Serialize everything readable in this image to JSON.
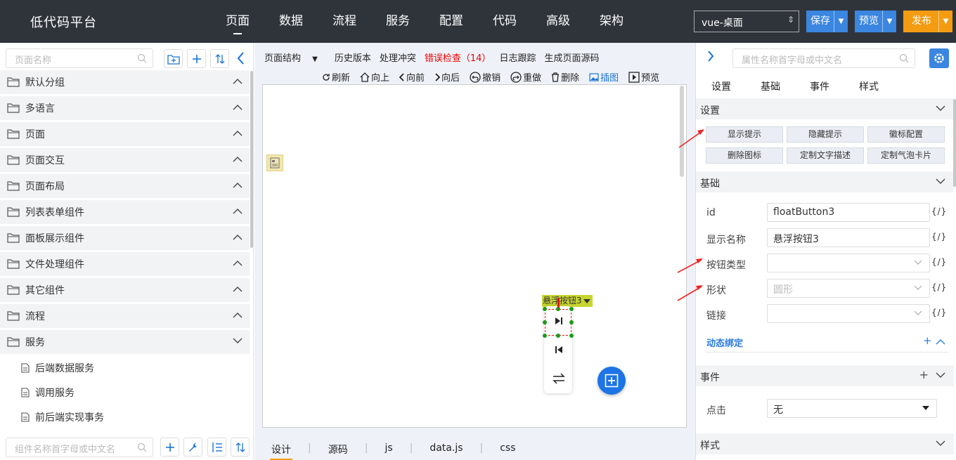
{
  "header": {
    "logo": "低代码平台",
    "nav": [
      "页面",
      "数据",
      "流程",
      "服务",
      "配置",
      "代码",
      "高级",
      "架构"
    ],
    "active_nav": "页面",
    "platform_select": "vue-桌面",
    "save_label": "保存",
    "preview_label": "预览",
    "publish_label": "发布",
    "colors": {
      "bar": "#2f343b",
      "save": "#3a86e0",
      "preview": "#3a86e0",
      "publish": "#f39c12"
    }
  },
  "left": {
    "search_placeholder": "页面名称",
    "groups": [
      {
        "label": "默认分组",
        "expanded": false
      },
      {
        "label": "多语言",
        "expanded": false
      },
      {
        "label": "页面",
        "expanded": false
      },
      {
        "label": "页面交互",
        "expanded": false
      },
      {
        "label": "页面布局",
        "expanded": false
      },
      {
        "label": "列表表单组件",
        "expanded": false
      },
      {
        "label": "面板展示组件",
        "expanded": false
      },
      {
        "label": "文件处理组件",
        "expanded": false
      },
      {
        "label": "其它组件",
        "expanded": false
      },
      {
        "label": "流程",
        "expanded": false
      },
      {
        "label": "服务",
        "expanded": true
      }
    ],
    "service_items": [
      "后端数据服务",
      "调用服务",
      "前后端实现事务"
    ],
    "component_search_placeholder": "组件名称首字母或中文名"
  },
  "center": {
    "toolbar": {
      "page_structure": "页面结构",
      "history": "历史版本",
      "conflict": "处理冲突",
      "error_check": "错误检查（14）",
      "log": "日志跟踪",
      "gen_source": "生成页面源码"
    },
    "actions": {
      "refresh": "刷新",
      "up": "向上",
      "forward": "向前",
      "back": "向后",
      "undo": "撤销",
      "redo": "重做",
      "delete": "删除",
      "insert_image": "插图",
      "preview": "预览"
    },
    "selected_label": "悬浮按钮3",
    "tabs": [
      "设计",
      "源码",
      "js",
      "data.js",
      "css"
    ],
    "active_tab": "设计"
  },
  "right": {
    "search_placeholder": "属性名称首字母或中文名",
    "tabs": [
      "设置",
      "基础",
      "事件",
      "样式"
    ],
    "sections": {
      "settings": "设置",
      "basic": "基础",
      "events": "事件",
      "style": "样式"
    },
    "setting_buttons": [
      "显示提示",
      "隐藏提示",
      "徽标配置",
      "删除图标",
      "定制文字描述",
      "定制气泡卡片"
    ],
    "fields": {
      "id_label": "id",
      "id_value": "floatButton3",
      "name_label": "显示名称",
      "name_value": "悬浮按钮3",
      "btn_type_label": "按钮类型",
      "btn_type_value": "",
      "shape_label": "形状",
      "shape_placeholder": "圆形",
      "link_label": "链接",
      "link_value": ""
    },
    "expr_marker": "{/}",
    "dynamic_binding": "动态绑定",
    "event_click_label": "点击",
    "event_click_value": "无"
  }
}
